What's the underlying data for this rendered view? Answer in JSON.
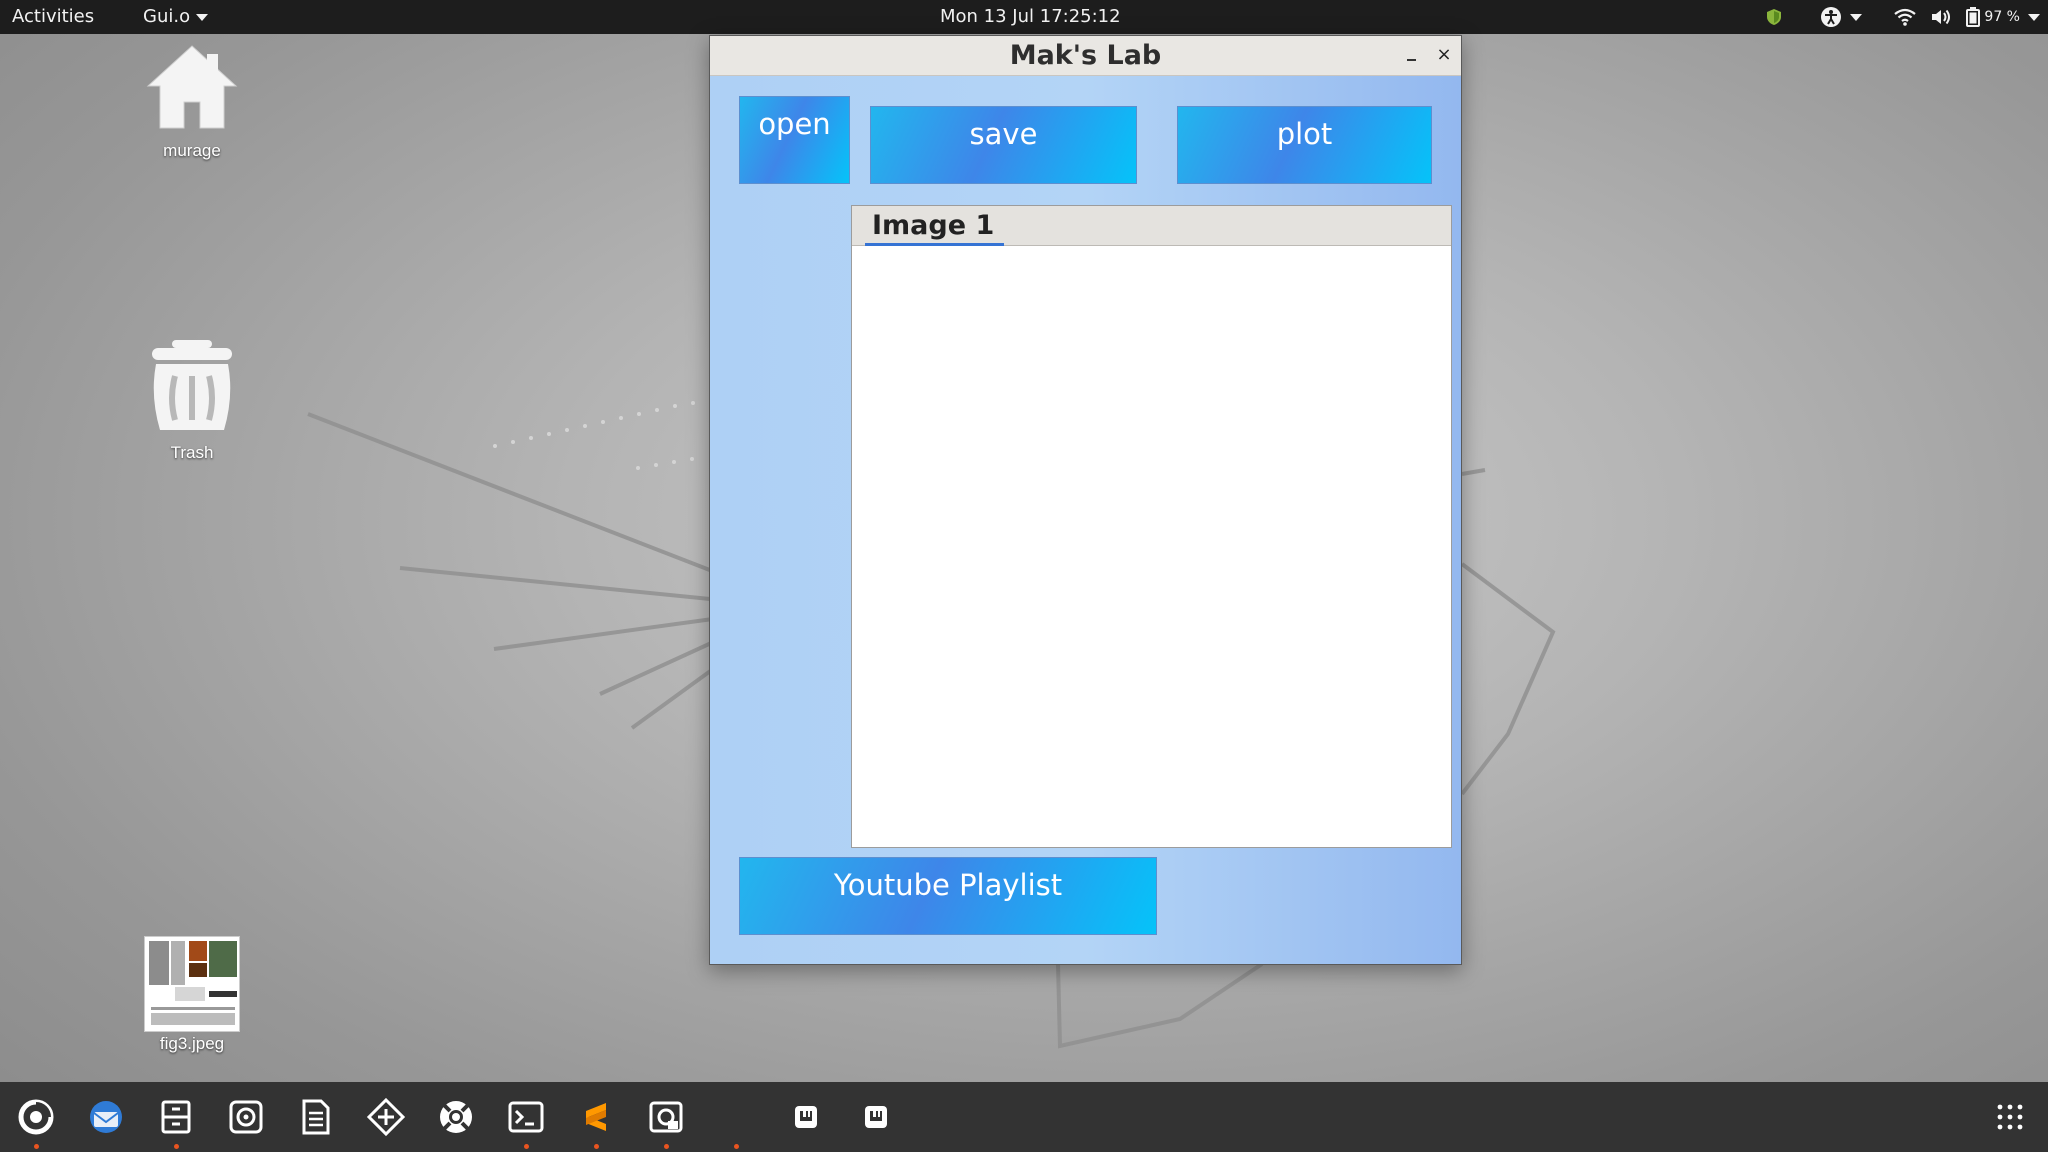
{
  "topbar": {
    "activities": "Activities",
    "app_menu": "Gui.o",
    "clock": "Mon 13 Jul  17:25:12",
    "battery_percent": "97 %"
  },
  "desktop": {
    "icons": [
      {
        "label": "murage",
        "icon": "home-folder-icon"
      },
      {
        "label": "Trash",
        "icon": "trash-icon"
      },
      {
        "label": "fig3.jpeg",
        "icon": "image-thumbnail"
      }
    ]
  },
  "window": {
    "title": "Mak's Lab",
    "minimize_icon": "minimize-icon",
    "close_label": "×",
    "buttons": {
      "open": "open",
      "save": "save",
      "plot": "plot",
      "playlist": "Youtube Playlist"
    },
    "tabs": [
      {
        "label": "Image 1",
        "active": true
      }
    ],
    "accent_color": "#3573d4",
    "button_gradient": [
      "#22b6ee",
      "#3e86e9",
      "#05c3f9"
    ]
  },
  "dock": {
    "apps": [
      {
        "name": "firefox",
        "icon": "firefox-icon",
        "running": true
      },
      {
        "name": "thunderbird",
        "icon": "thunderbird-icon",
        "running": false
      },
      {
        "name": "files",
        "icon": "files-icon",
        "running": true
      },
      {
        "name": "rhythmbox",
        "icon": "rhythmbox-icon",
        "running": false
      },
      {
        "name": "writer",
        "icon": "writer-icon",
        "running": false
      },
      {
        "name": "software",
        "icon": "software-icon",
        "running": false
      },
      {
        "name": "help",
        "icon": "help-icon",
        "running": false
      },
      {
        "name": "terminal",
        "icon": "terminal-icon",
        "running": true
      },
      {
        "name": "sublime-text",
        "icon": "sublime-icon",
        "running": true
      },
      {
        "name": "screenshot",
        "icon": "screenshot-icon",
        "running": true
      },
      {
        "name": "gui-app",
        "icon": "running-app-indicator",
        "running": true
      },
      {
        "name": "window-1",
        "icon": "window-icon",
        "running": false
      },
      {
        "name": "window-2",
        "icon": "window-icon",
        "running": false
      }
    ],
    "show_apps_icon": "app-grid-icon"
  }
}
